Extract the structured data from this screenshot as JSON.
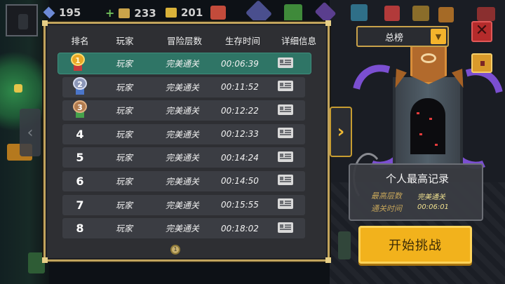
{
  "resources": [
    {
      "icon": "gem-icon",
      "value": "195"
    },
    {
      "icon": "plus-icon",
      "value": "233"
    },
    {
      "icon": "coin-icon",
      "value": "201"
    }
  ],
  "leaderboard": {
    "headers": [
      "排名",
      "玩家",
      "冒险层数",
      "生存时间",
      "详细信息"
    ],
    "rows": [
      {
        "rank": "1",
        "medal": "gold",
        "player": "玩家",
        "floors": "完美通关",
        "time": "00:06:39",
        "highlight": true
      },
      {
        "rank": "2",
        "medal": "silver",
        "player": "玩家",
        "floors": "完美通关",
        "time": "00:11:52"
      },
      {
        "rank": "3",
        "medal": "bronze",
        "player": "玩家",
        "floors": "完美通关",
        "time": "00:12:22"
      },
      {
        "rank": "4",
        "player": "玩家",
        "floors": "完美通关",
        "time": "00:12:33"
      },
      {
        "rank": "5",
        "player": "玩家",
        "floors": "完美通关",
        "time": "00:14:24"
      },
      {
        "rank": "6",
        "player": "玩家",
        "floors": "完美通关",
        "time": "00:14:50"
      },
      {
        "rank": "7",
        "player": "玩家",
        "floors": "完美通关",
        "time": "00:15:55"
      },
      {
        "rank": "8",
        "player": "玩家",
        "floors": "完美通关",
        "time": "00:18:02"
      }
    ],
    "page_indicator": "1"
  },
  "dropdown": {
    "selected": "总榜"
  },
  "personal_record": {
    "title": "个人最高记录",
    "floors_label": "最高层数",
    "floors_value": "完美通关",
    "time_label": "通关时间",
    "time_value": "00:06:01"
  },
  "start_button": {
    "label": "开始挑战"
  },
  "colors": {
    "panel_border": "#c2a45c",
    "highlight_row": "#2f7566",
    "accent_yellow": "#f2b21c",
    "close_red": "#b52b2b",
    "tentacle_purple": "#7b4fd1"
  }
}
